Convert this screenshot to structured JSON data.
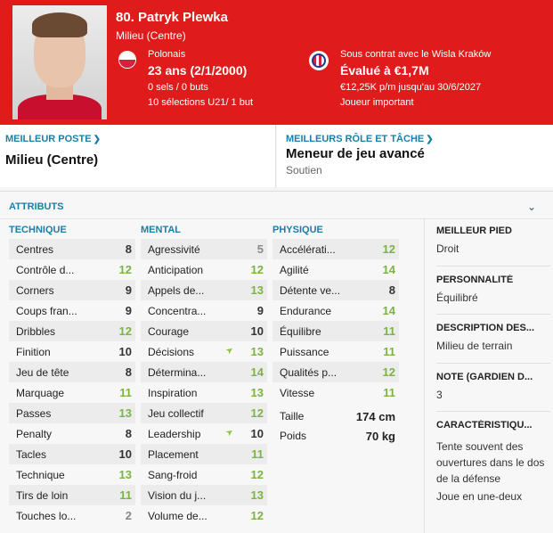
{
  "header": {
    "name": "80. Patryk Plewka",
    "position": "Milieu (Centre)",
    "nationality": "Polonais",
    "age": "23 ans (2/1/2000)",
    "caps_goals": "0 sels / 0 buts",
    "u21": "10 sélections U21/ 1 but",
    "contract": "Sous contrat avec le Wisla Kraków",
    "value": "Évalué à €1,7M",
    "wage": "€12,25K p/m jusqu'au 30/6/2027",
    "status": "Joueur important",
    "colors": {
      "header_bg": "#e01b1b",
      "accent": "#1a7fa8"
    }
  },
  "best_position": {
    "label": "MEILLEUR POSTE",
    "value": "Milieu (Centre)"
  },
  "best_role": {
    "label": "MEILLEURS RÔLE ET TÂCHE",
    "value": "Meneur de jeu avancé",
    "duty": "Soutien"
  },
  "attributes": {
    "title": "ATTRIBUTS",
    "technical": {
      "heading": "TECHNIQUE",
      "items": [
        {
          "name": "Centres",
          "value": "8"
        },
        {
          "name": "Contrôle d...",
          "value": "12"
        },
        {
          "name": "Corners",
          "value": "9"
        },
        {
          "name": "Coups fran...",
          "value": "9"
        },
        {
          "name": "Dribbles",
          "value": "12"
        },
        {
          "name": "Finition",
          "value": "10"
        },
        {
          "name": "Jeu de tête",
          "value": "8"
        },
        {
          "name": "Marquage",
          "value": "11"
        },
        {
          "name": "Passes",
          "value": "13"
        },
        {
          "name": "Penalty",
          "value": "8"
        },
        {
          "name": "Tacles",
          "value": "10"
        },
        {
          "name": "Technique",
          "value": "13"
        },
        {
          "name": "Tirs de loin",
          "value": "11"
        },
        {
          "name": "Touches lo...",
          "value": "2"
        }
      ]
    },
    "mental": {
      "heading": "MENTAL",
      "items": [
        {
          "name": "Agressivité",
          "value": "5"
        },
        {
          "name": "Anticipation",
          "value": "12"
        },
        {
          "name": "Appels de...",
          "value": "13"
        },
        {
          "name": "Concentra...",
          "value": "9"
        },
        {
          "name": "Courage",
          "value": "10"
        },
        {
          "name": "Décisions",
          "value": "13"
        },
        {
          "name": "Détermina...",
          "value": "14"
        },
        {
          "name": "Inspiration",
          "value": "13"
        },
        {
          "name": "Jeu collectif",
          "value": "12"
        },
        {
          "name": "Leadership",
          "value": "10"
        },
        {
          "name": "Placement",
          "value": "11"
        },
        {
          "name": "Sang-froid",
          "value": "12"
        },
        {
          "name": "Vision du j...",
          "value": "13"
        },
        {
          "name": "Volume de...",
          "value": "12"
        }
      ]
    },
    "physical": {
      "heading": "PHYSIQUE",
      "items": [
        {
          "name": "Accélérati...",
          "value": "12"
        },
        {
          "name": "Agilité",
          "value": "14"
        },
        {
          "name": "Détente ve...",
          "value": "8"
        },
        {
          "name": "Endurance",
          "value": "14"
        },
        {
          "name": "Équilibre",
          "value": "11"
        },
        {
          "name": "Puissance",
          "value": "11"
        },
        {
          "name": "Qualités p...",
          "value": "12"
        },
        {
          "name": "Vitesse",
          "value": "11"
        }
      ],
      "height_label": "Taille",
      "height": "174 cm",
      "weight_label": "Poids",
      "weight": "70 kg"
    }
  },
  "sidebar": {
    "foot_label": "MEILLEUR PIED",
    "foot": "Droit",
    "personality_label": "PERSONNALITÉ",
    "personality": "Équilibré",
    "description_label": "DESCRIPTION DES...",
    "description": "Milieu de terrain",
    "gk_label": "NOTE (GARDIEN D...",
    "gk": "3",
    "traits_label": "CARACTÉRISTIQU...",
    "trait1": "Tente souvent des ouvertures dans le dos de la défense",
    "trait2": "Joue en une-deux"
  }
}
